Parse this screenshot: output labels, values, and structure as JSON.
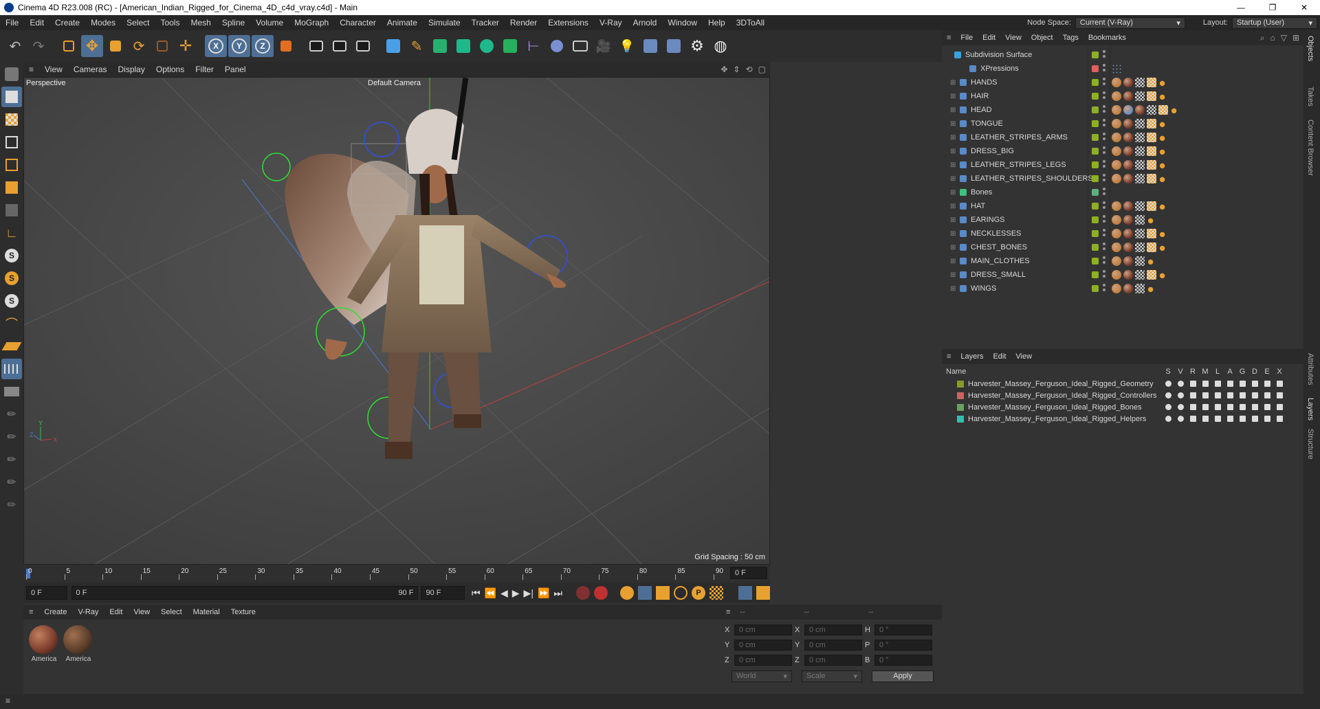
{
  "window": {
    "title": "Cinema 4D R23.008 (RC) - [American_Indian_Rigged_for_Cinema_4D_c4d_vray.c4d] - Main",
    "controls": [
      "—",
      "❐",
      "✕"
    ]
  },
  "menubar": {
    "items": [
      "File",
      "Edit",
      "Create",
      "Modes",
      "Select",
      "Tools",
      "Mesh",
      "Spline",
      "Volume",
      "MoGraph",
      "Character",
      "Animate",
      "Simulate",
      "Tracker",
      "Render",
      "Extensions",
      "V-Ray",
      "Arnold",
      "Window",
      "Help",
      "3DToAll"
    ],
    "node_space_label": "Node Space:",
    "node_space_value": "Current (V-Ray)",
    "layout_label": "Layout:",
    "layout_value": "Startup (User)"
  },
  "viewport": {
    "menu": [
      "View",
      "Cameras",
      "Display",
      "Options",
      "Filter",
      "Panel"
    ],
    "projection": "Perspective",
    "camera": "Default Camera",
    "grid_spacing": "Grid Spacing : 50 cm",
    "axis_labels": [
      "Y",
      "Z",
      "X"
    ]
  },
  "timeline": {
    "ticks": [
      "0",
      "5",
      "10",
      "15",
      "20",
      "25",
      "30",
      "35",
      "40",
      "45",
      "50",
      "55",
      "60",
      "65",
      "70",
      "75",
      "80",
      "85",
      "90"
    ],
    "current_frame_right": "0 F",
    "start_field": "0 F",
    "slider_label": "0 F",
    "slider_end": "90 F",
    "end_field": "90 F"
  },
  "materials": {
    "menu": [
      "Create",
      "V-Ray",
      "Edit",
      "View",
      "Select",
      "Material",
      "Texture"
    ],
    "items": [
      {
        "label": "America",
        "color": "#7a3b2a"
      },
      {
        "label": "America",
        "color": "#5a3d2a"
      }
    ]
  },
  "coords": {
    "col_headers": [
      "--",
      "--",
      "--"
    ],
    "rows": [
      {
        "a": "X",
        "a_val": "0 cm",
        "b": "X",
        "b_val": "0 cm",
        "c": "H",
        "c_val": "0 °"
      },
      {
        "a": "Y",
        "a_val": "0 cm",
        "b": "Y",
        "b_val": "0 cm",
        "c": "P",
        "c_val": "0 °"
      },
      {
        "a": "Z",
        "a_val": "0 cm",
        "b": "Z",
        "b_val": "0 cm",
        "c": "B",
        "c_val": "0 °"
      }
    ],
    "world": "World",
    "scale": "Scale",
    "apply": "Apply"
  },
  "object_manager": {
    "menu": [
      "File",
      "Edit",
      "View",
      "Object",
      "Tags",
      "Bookmarks"
    ],
    "objects": [
      {
        "name": "Subdivision Surface",
        "vis": "#8fb020"
      },
      {
        "name": "XPressions",
        "vis": "#e06060"
      },
      {
        "name": "HANDS",
        "vis": "#8fb020"
      },
      {
        "name": "HAIR",
        "vis": "#8fb020"
      },
      {
        "name": "HEAD",
        "vis": "#8fb020"
      },
      {
        "name": "TONGUE",
        "vis": "#8fb020"
      },
      {
        "name": "LEATHER_STRIPES_ARMS",
        "vis": "#8fb020"
      },
      {
        "name": "DRESS_BIG",
        "vis": "#8fb020"
      },
      {
        "name": "LEATHER_STRIPES_LEGS",
        "vis": "#8fb020"
      },
      {
        "name": "LEATHER_STRIPES_SHOULDERS",
        "vis": "#8fb020"
      },
      {
        "name": "Bones",
        "vis": "#5fb080"
      },
      {
        "name": "HAT",
        "vis": "#8fb020"
      },
      {
        "name": "EARINGS",
        "vis": "#8fb020"
      },
      {
        "name": "NECKLESSES",
        "vis": "#8fb020"
      },
      {
        "name": "CHEST_BONES",
        "vis": "#8fb020"
      },
      {
        "name": "MAIN_CLOTHES",
        "vis": "#8fb020"
      },
      {
        "name": "DRESS_SMALL",
        "vis": "#8fb020"
      },
      {
        "name": "WINGS",
        "vis": "#8fb020"
      }
    ]
  },
  "layers": {
    "menu": [
      "Layers",
      "Edit",
      "View"
    ],
    "name_header": "Name",
    "flag_headers": [
      "S",
      "V",
      "R",
      "M",
      "L",
      "A",
      "G",
      "D",
      "E",
      "X"
    ],
    "rows": [
      {
        "name": "Harvester_Massey_Ferguson_Ideal_Rigged_Geometry",
        "color": "#8a9a2a"
      },
      {
        "name": "Harvester_Massey_Ferguson_Ideal_Rigged_Controllers",
        "color": "#d06060"
      },
      {
        "name": "Harvester_Massey_Ferguson_Ideal_Rigged_Bones",
        "color": "#6aa060"
      },
      {
        "name": "Harvester_Massey_Ferguson_Ideal_Rigged_Helpers",
        "color": "#30c0b0"
      }
    ]
  },
  "side_tabs": [
    "Objects",
    "Takes",
    "Content Browser",
    "Attributes",
    "Layers",
    "Structure"
  ]
}
